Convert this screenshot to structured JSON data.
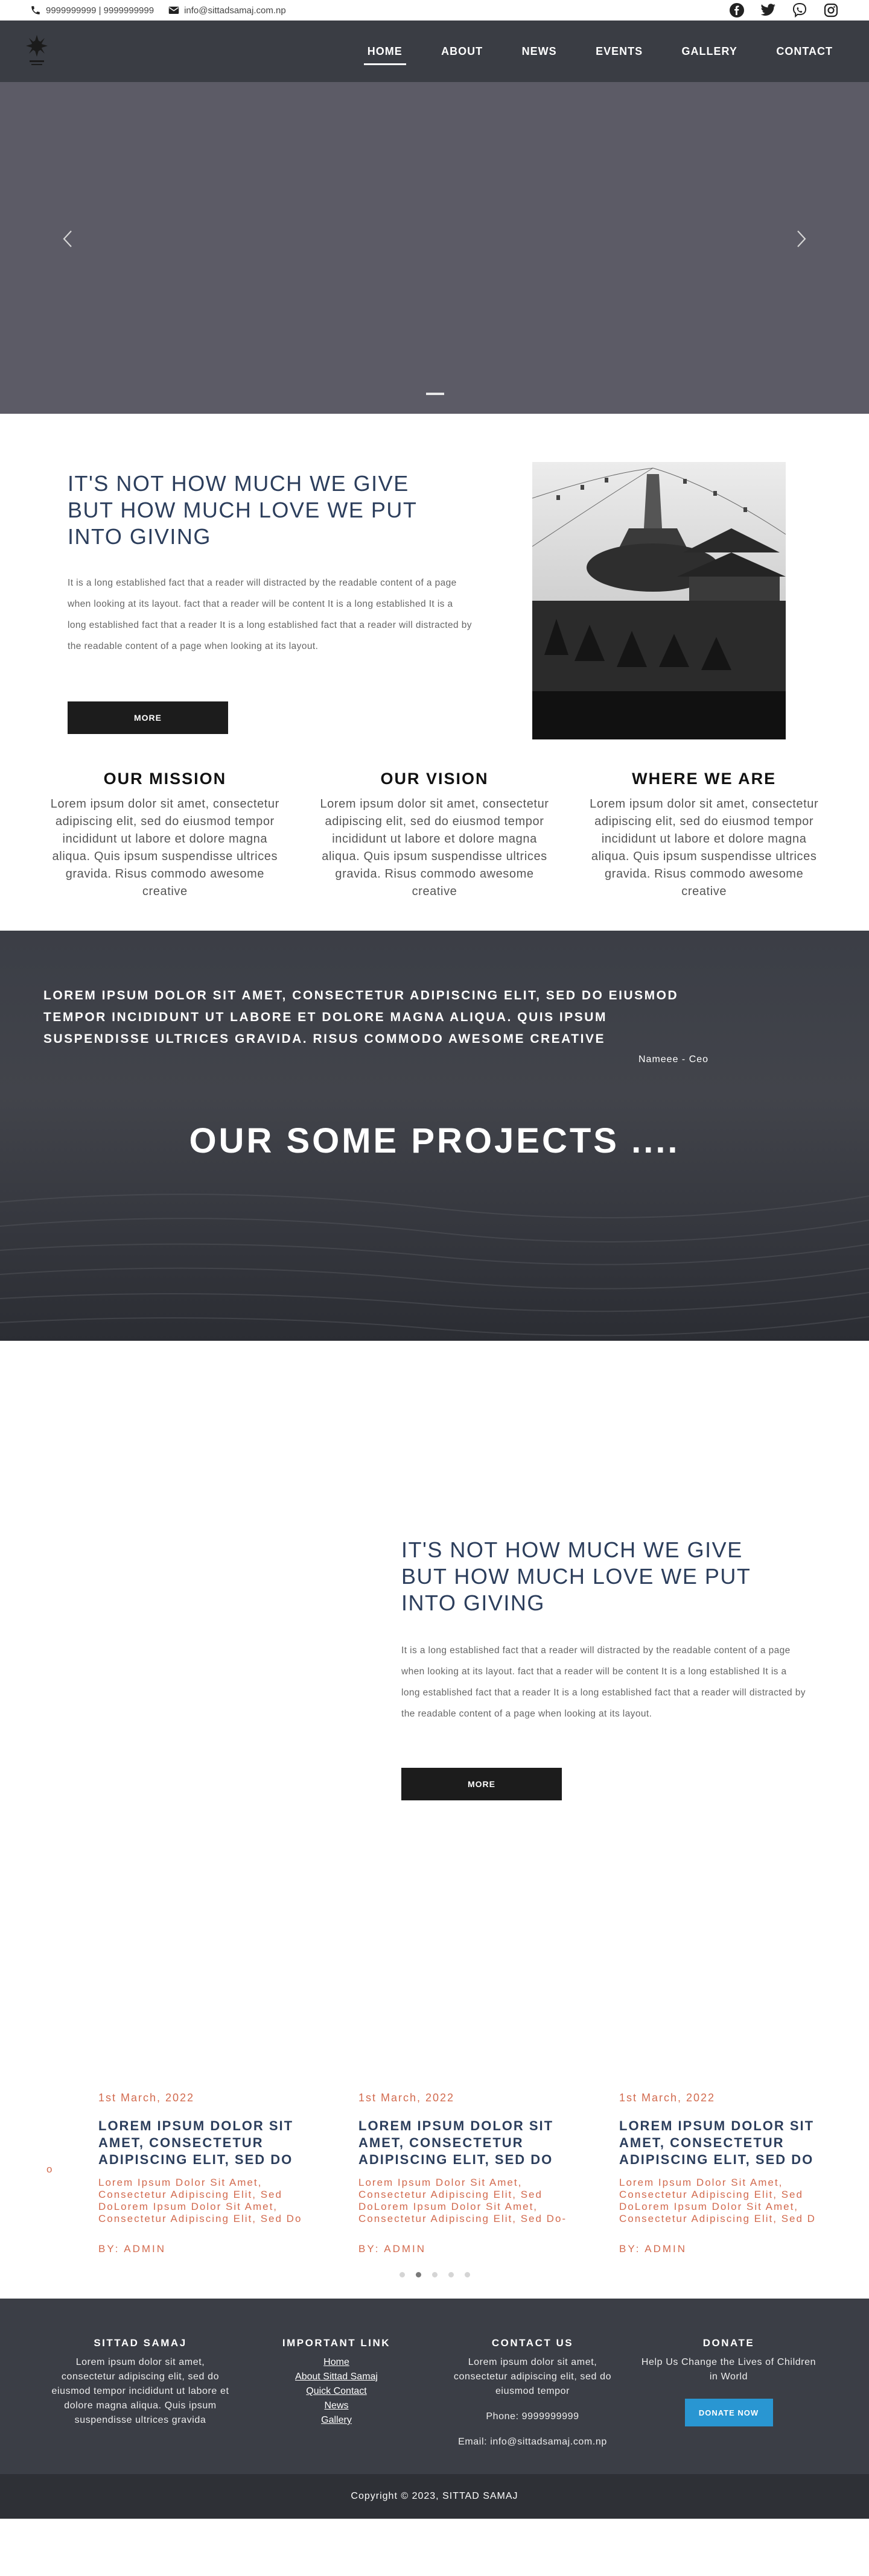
{
  "topbar": {
    "phone": "9999999999 | 9999999999",
    "email": "info@sittadsamaj.com.np",
    "socials": [
      "facebook-icon",
      "twitter-icon",
      "viber-icon",
      "instagram-icon"
    ]
  },
  "nav": {
    "items": [
      "HOME",
      "ABOUT",
      "NEWS",
      "EVENTS",
      "GALLERY",
      "CONTACT"
    ],
    "active": "HOME"
  },
  "about1": {
    "heading": "IT'S NOT HOW MUCH WE GIVE BUT HOW MUCH LOVE WE PUT INTO GIVING",
    "text": "It is a long established fact that a reader will distracted by the readable content of a page when looking at its layout. fact that a reader will be content It is a long established It is a long established fact that a reader It is a long established fact that a reader will distracted by the readable content of a page when looking at its layout.",
    "button": "MORE"
  },
  "mvw": [
    {
      "title": "OUR MISSION",
      "text": "Lorem ipsum dolor sit amet, consectetur adipiscing elit, sed do eiusmod tempor incididunt ut labore et dolore magna aliqua. Quis ipsum suspendisse ultrices gravida. Risus commodo awesome creative"
    },
    {
      "title": "OUR VISION",
      "text": "Lorem ipsum dolor sit amet, consectetur adipiscing elit, sed do eiusmod tempor incididunt ut labore et dolore magna aliqua. Quis ipsum suspendisse ultrices gravida. Risus commodo awesome creative"
    },
    {
      "title": "WHERE WE ARE",
      "text": "Lorem ipsum dolor sit amet, consectetur adipiscing elit, sed do eiusmod tempor incididunt ut labore et dolore magna aliqua. Quis ipsum suspendisse ultrices gravida. Risus commodo awesome creative"
    }
  ],
  "quote": {
    "text": "LOREM IPSUM DOLOR SIT AMET, CONSECTETUR ADIPISCING ELIT, SED DO EIUSMOD TEMPOR INCIDIDUNT UT LABORE ET DOLORE MAGNA ALIQUA. QUIS IPSUM SUSPENDISSE ULTRICES GRAVIDA. RISUS COMMODO AWESOME CREATIVE",
    "author": "Nameee - Ceo",
    "projects_heading": "OUR SOME PROJECTS ...."
  },
  "about2": {
    "heading": "IT'S NOT HOW MUCH WE GIVE BUT HOW MUCH LOVE WE PUT INTO GIVING",
    "text": "It is a long established fact that a reader will distracted by the readable content of a page when looking at its layout. fact that a reader will be content It is a long established It is a long established fact that a reader It is a long established fact that a reader will distracted by the readable content of a page when looking at its layout.",
    "button": "MORE"
  },
  "news": {
    "fragment": "o",
    "cards": [
      {
        "date": "1st March, 2022",
        "title": "LOREM IPSUM DOLOR SIT AMET, CONSECTETUR ADIPISCING ELIT, SED DO",
        "excerpt": "Lorem Ipsum Dolor Sit Amet, Consectetur Adipiscing Elit, Sed DoLorem Ipsum Dolor Sit Amet, Consectetur Adipiscing Elit, Sed Do",
        "by": "BY: ADMIN"
      },
      {
        "date": "1st March, 2022",
        "title": "LOREM IPSUM DOLOR SIT AMET, CONSECTETUR ADIPISCING ELIT, SED DO",
        "excerpt": "Lorem Ipsum Dolor Sit Amet, Consectetur Adipiscing Elit, Sed DoLorem Ipsum Dolor Sit Amet, Consectetur Adipiscing Elit, Sed Do-",
        "by": "BY: ADMIN"
      },
      {
        "date": "1st March, 2022",
        "title": "LOREM IPSUM DOLOR SIT AMET, CONSECTETUR ADIPISCING ELIT, SED DO",
        "excerpt": "Lorem Ipsum Dolor Sit Amet, Consectetur Adipiscing Elit, Sed DoLorem Ipsum Dolor Sit Amet, Consectetur Adipiscing Elit, Sed D",
        "by": "BY: ADMIN"
      }
    ]
  },
  "footer": {
    "col1": {
      "title": "SITTAD SAMAJ",
      "text": "Lorem ipsum dolor sit amet, consectetur adipiscing elit, sed do eiusmod tempor incididunt ut labore et dolore magna aliqua. Quis ipsum suspendisse ultrices gravida"
    },
    "col2": {
      "title": "IMPORTANT LINK",
      "links": [
        "Home",
        "About Sittad Samaj",
        "Quick Contact",
        "News",
        "Gallery"
      ]
    },
    "col3": {
      "title": "CONTACT US",
      "text": "Lorem ipsum dolor sit amet, consectetur adipiscing elit, sed do eiusmod tempor",
      "phone": "Phone: 9999999999",
      "email": "Email: info@sittadsamaj.com.np"
    },
    "col4": {
      "title": "DONATE",
      "text": "Help Us Change the Lives of Children in World",
      "button": "DONATE NOW"
    },
    "copyright": "Copyright © 2023, SITTAD SAMAJ"
  },
  "colors": {
    "nav_bg": "#3a3d44",
    "hero_bg": "#5c5b66",
    "heading_blue": "#2c3e5c",
    "accent_orange": "#d26a4e",
    "donate_blue": "#2996d2"
  }
}
